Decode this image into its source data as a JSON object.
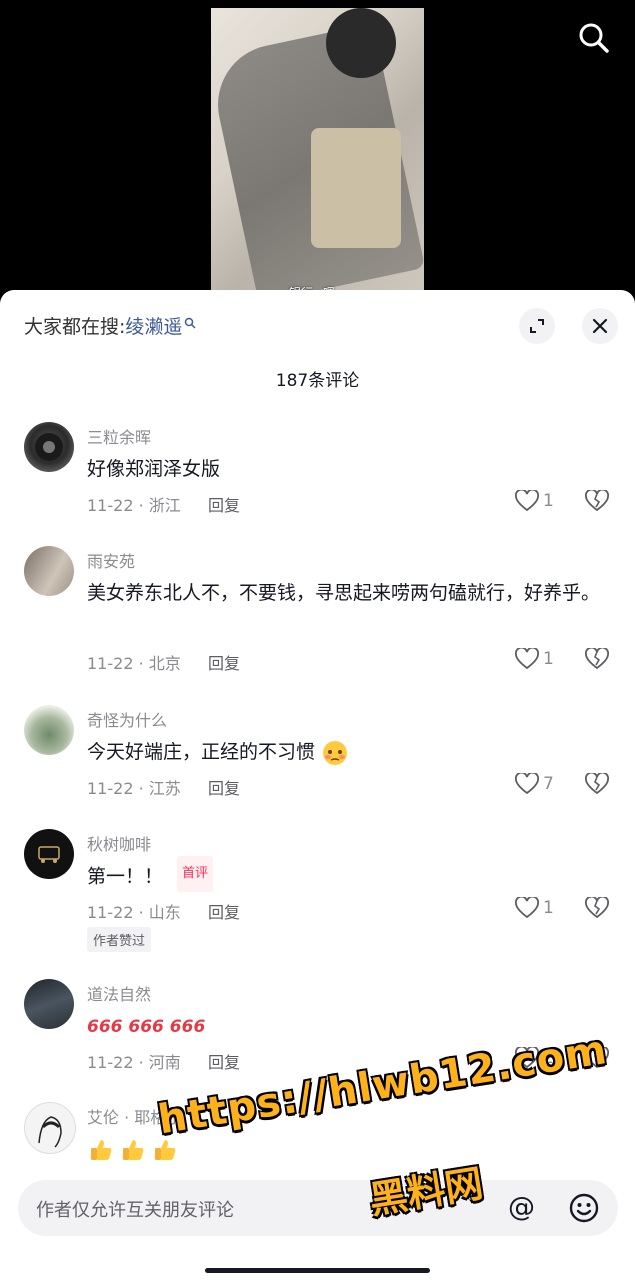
{
  "video": {
    "subtitle": "银行~嗯"
  },
  "panel": {
    "search_prefix": "大家都在搜:",
    "search_keyword": "绫濑遥",
    "comment_count": "187条评论"
  },
  "comments": [
    {
      "user": "三粒余晖",
      "text": "好像郑润泽女版",
      "date": "11-22 · 浙江",
      "reply": "回复",
      "likes": "1"
    },
    {
      "user": "雨安苑",
      "text": "美女养东北人不，不要钱，寻思起来唠两句磕就行，好养乎。",
      "date": "11-22 · 北京",
      "reply": "回复",
      "likes": "1"
    },
    {
      "user": "奇怪为什么",
      "text": "今天好端庄，正经的不习惯",
      "date": "11-22 · 江苏",
      "reply": "回复",
      "likes": "7"
    },
    {
      "user": "秋树咖啡",
      "text": "第一！！",
      "tag": "首评",
      "date": "11-22 · 山东",
      "reply": "回复",
      "likes": "1",
      "badge": "作者赞过"
    },
    {
      "user": "道法自然",
      "text": "666 666 666",
      "date": "11-22 · 河南",
      "reply": "回复",
      "likes": "2"
    },
    {
      "user": "艾伦 · 耶格尔",
      "text": ""
    }
  ],
  "input": {
    "placeholder": "作者仅允许互关朋友评论"
  },
  "watermark": {
    "line1": "https://hlwb12.com",
    "line2": "黑料网"
  },
  "colors": {
    "accent": "#fe2c55",
    "link": "#3c5a99",
    "watermark": "#ffb11c"
  }
}
